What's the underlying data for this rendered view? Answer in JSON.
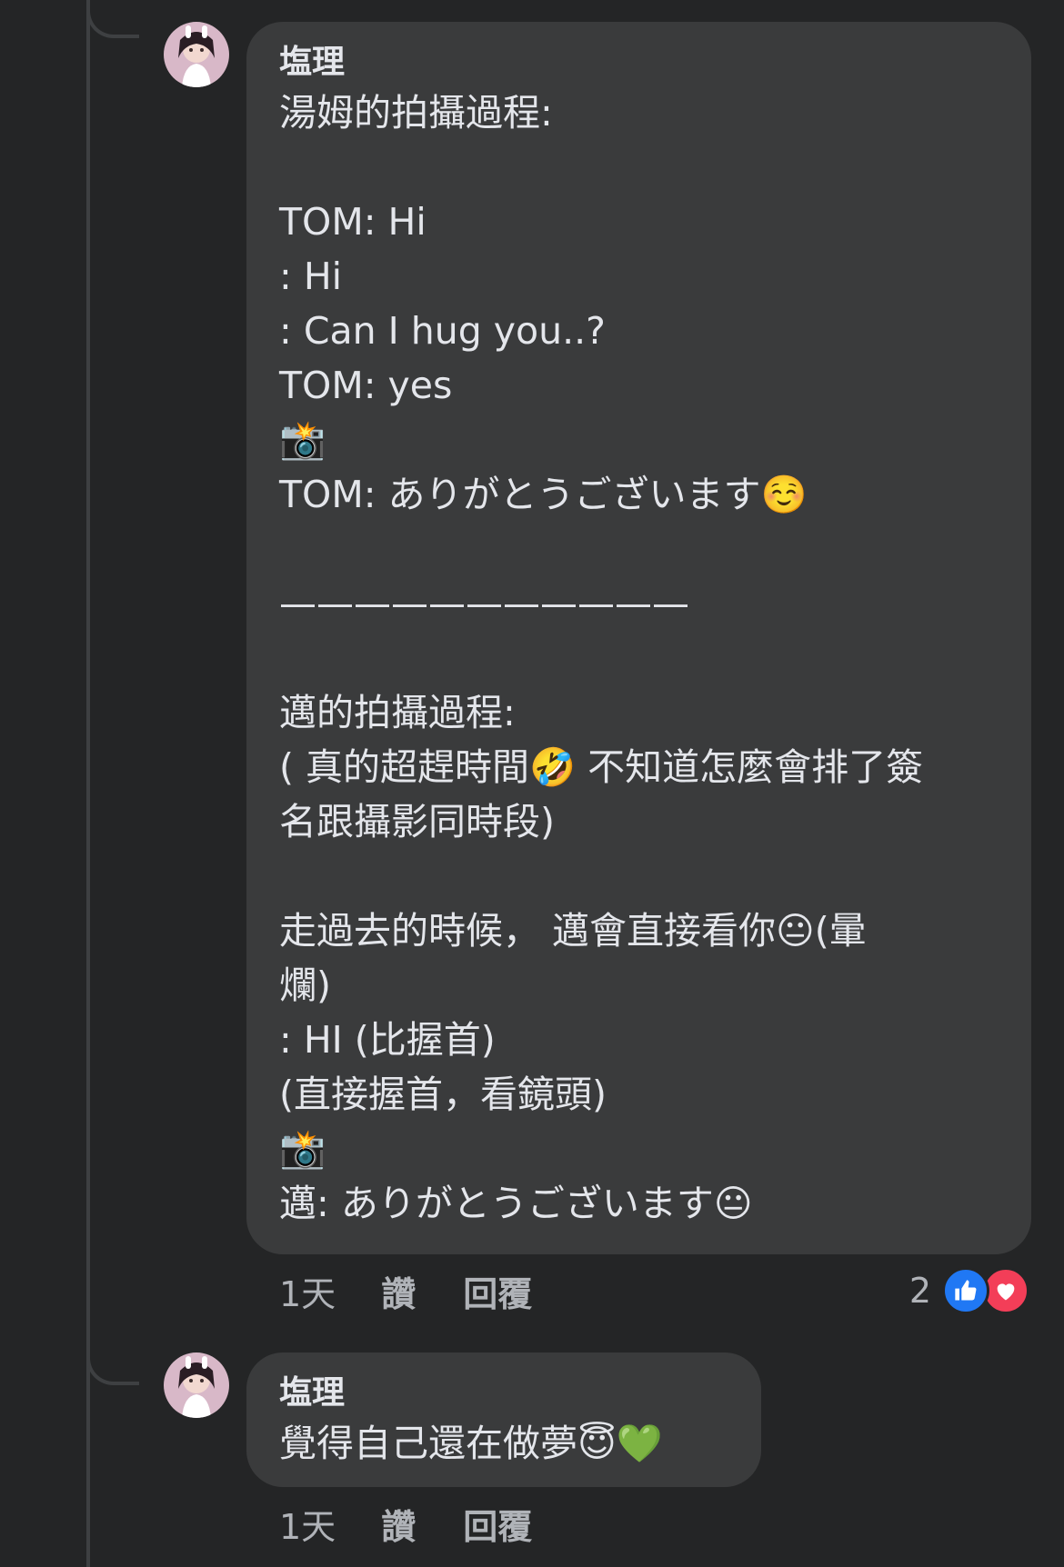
{
  "comments": [
    {
      "author": "塩理",
      "lines": [
        "湯姆的拍攝過程:",
        "",
        "TOM: Hi",
        ": Hi",
        ": Can I hug you..?",
        "TOM: yes",
        "📸",
        "TOM: ありがとうございます☺️",
        "",
        "———————————",
        "",
        "邁的拍攝過程:",
        "( 真的超趕時間🤣 不知道怎麼會排了簽",
        "名跟攝影同時段)",
        "",
        "走過去的時候， 邁會直接看你😐(暈",
        "爛)",
        ": HI (比握首)",
        "(直接握首，看鏡頭)",
        "📸",
        "邁: ありがとうございます😐"
      ],
      "time": "1天",
      "like_label": "讚",
      "reply_label": "回覆",
      "reaction_count": "2",
      "reaction_icons": [
        "like-icon",
        "love-icon"
      ]
    },
    {
      "author": "塩理",
      "lines": [
        "覺得自己還在做夢😇💚"
      ],
      "time": "1天",
      "like_label": "讚",
      "reply_label": "回覆"
    }
  ],
  "colors": {
    "background": "#242526",
    "bubble": "#3a3b3c",
    "text": "#e4e6eb",
    "secondary_text": "#b0b3b8",
    "like": "#2078f4",
    "love": "#f33e58"
  }
}
